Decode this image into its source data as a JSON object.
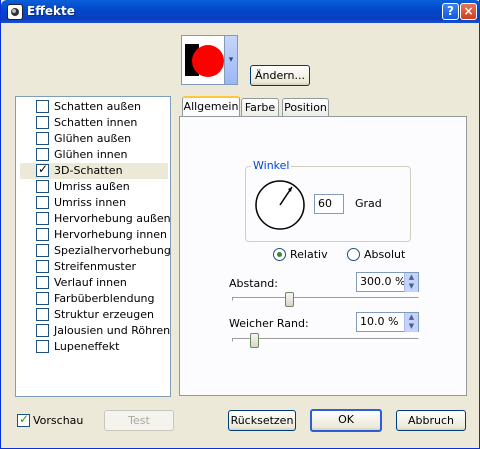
{
  "window": {
    "title": "Effekte",
    "help_label": "?",
    "close_label": "×"
  },
  "preview": {
    "dropdown_arrow": "▾",
    "change_button": "Ändern...",
    "preview_colors": {
      "shadow": "#000000",
      "fill": "#ff0000"
    }
  },
  "effects": {
    "items": [
      {
        "label": "Schatten außen",
        "checked": false
      },
      {
        "label": "Schatten innen",
        "checked": false
      },
      {
        "label": "Glühen außen",
        "checked": false
      },
      {
        "label": "Glühen innen",
        "checked": false
      },
      {
        "label": "3D-Schatten",
        "checked": true
      },
      {
        "label": "Umriss außen",
        "checked": false
      },
      {
        "label": "Umriss innen",
        "checked": false
      },
      {
        "label": "Hervorhebung außen",
        "checked": false
      },
      {
        "label": "Hervorhebung innen",
        "checked": false
      },
      {
        "label": "Spezialhervorhebung",
        "checked": false
      },
      {
        "label": "Streifenmuster",
        "checked": false
      },
      {
        "label": "Verlauf innen",
        "checked": false
      },
      {
        "label": "Farbüberblendung",
        "checked": false
      },
      {
        "label": "Struktur erzeugen",
        "checked": false
      },
      {
        "label": "Jalousien und Röhren",
        "checked": false
      },
      {
        "label": "Lupeneffekt",
        "checked": false
      }
    ]
  },
  "tabs": [
    {
      "label": "Allgemein",
      "active": true
    },
    {
      "label": "Farbe",
      "active": false
    },
    {
      "label": "Position",
      "active": false
    }
  ],
  "angle": {
    "group_title": "Winkel",
    "value": "60",
    "unit": "Grad"
  },
  "mode": {
    "relative_label": "Relativ",
    "absolute_label": "Absolut",
    "selected": "Relativ"
  },
  "distance": {
    "label": "Abstand:",
    "value": "300.0 %",
    "slider_fraction": 0.3
  },
  "softness": {
    "label": "Weicher Rand:",
    "value": "10.0 %",
    "slider_fraction": 0.1
  },
  "footer": {
    "preview_label": "Vorschau",
    "preview_checked": true,
    "test_label": "Test",
    "reset_label": "Rücksetzen",
    "ok_label": "OK",
    "cancel_label": "Abbruch"
  },
  "colors": {
    "title_bar": "#0a53d6",
    "accent_tab": "#ffc83c",
    "group_title": "#0046d5"
  }
}
